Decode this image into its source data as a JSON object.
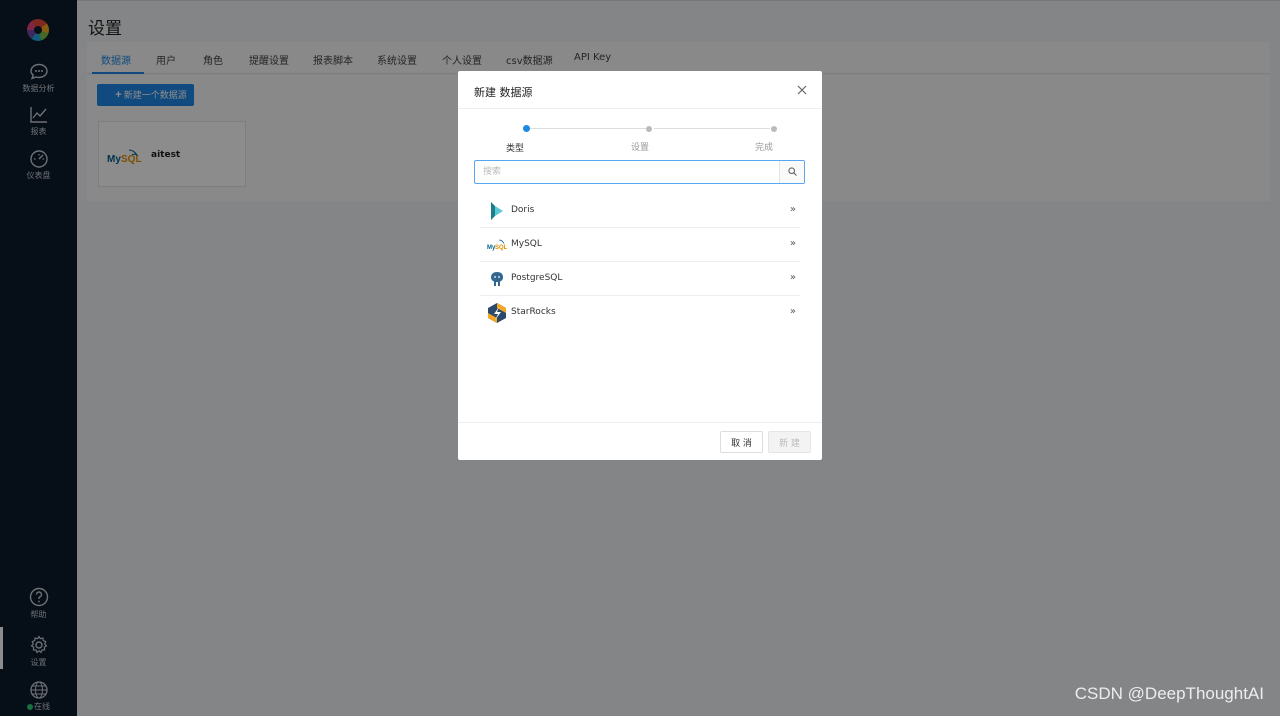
{
  "sidebar": {
    "items": [
      {
        "label": "数据分析",
        "icon": "chat-icon"
      },
      {
        "label": "报表",
        "icon": "line-chart-icon"
      },
      {
        "label": "仪表盘",
        "icon": "dashboard-icon"
      }
    ],
    "bottom": [
      {
        "label": "帮助",
        "icon": "help-icon"
      },
      {
        "label": "设置",
        "icon": "gear-icon"
      },
      {
        "label": "在线",
        "icon": "globe-icon"
      }
    ]
  },
  "page": {
    "title": "设置",
    "tabs": [
      "数据源",
      "用户",
      "角色",
      "提醒设置",
      "报表脚本",
      "系统设置",
      "个人设置",
      "csv数据源",
      "API Key"
    ],
    "active_tab": "数据源",
    "new_datasource_label": "新建一个数据源",
    "datasources": [
      {
        "name": "aitest",
        "type": "MySQL"
      }
    ]
  },
  "modal": {
    "title": "新建 数据源",
    "steps": [
      "类型",
      "设置",
      "完成"
    ],
    "active_step": 0,
    "search_placeholder": "搜索",
    "items": [
      {
        "name": "Doris",
        "icon": "doris-icon"
      },
      {
        "name": "MySQL",
        "icon": "mysql-icon"
      },
      {
        "name": "PostgreSQL",
        "icon": "postgresql-icon"
      },
      {
        "name": "StarRocks",
        "icon": "starrocks-icon"
      }
    ],
    "cancel_label": "取 消",
    "create_label": "新 建"
  },
  "logo_mysql_text": "MySQL",
  "watermark": "CSDN @DeepThoughtAI",
  "colors": {
    "sidebar_bg": "#0c1a2b",
    "accent": "#1e88e5",
    "online": "#2ecc71"
  }
}
